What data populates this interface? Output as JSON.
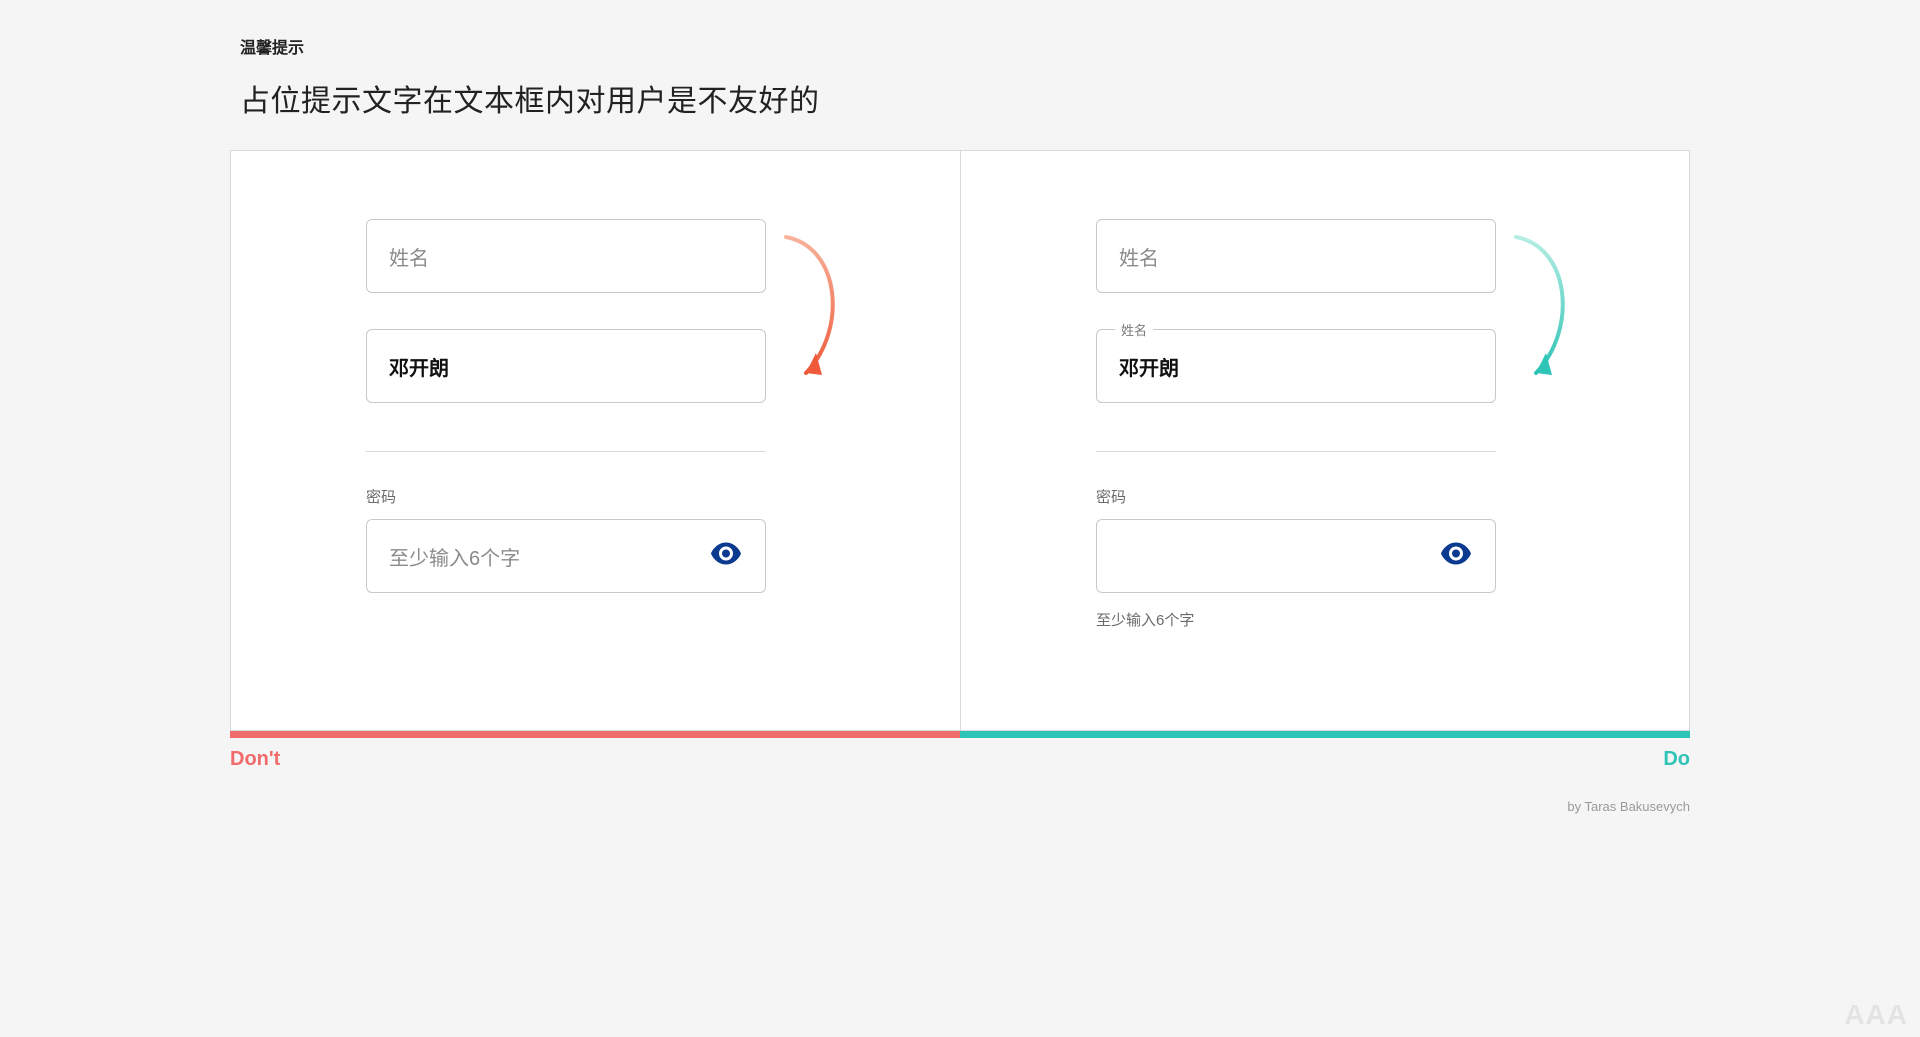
{
  "header": {
    "kicker": "温馨提示",
    "title": "占位提示文字在文本框内对用户是不友好的"
  },
  "colors": {
    "dont": "#f06b6b",
    "do": "#2ec4b6",
    "eye": "#0b3a8f"
  },
  "dont_panel": {
    "name_placeholder": "姓名",
    "name_value": "邓开朗",
    "password_label": "密码",
    "password_placeholder": "至少输入6个字"
  },
  "do_panel": {
    "name_placeholder": "姓名",
    "name_float_label": "姓名",
    "name_value": "邓开朗",
    "password_label": "密码",
    "password_help": "至少输入6个字"
  },
  "captions": {
    "dont": "Don't",
    "do": "Do"
  },
  "credit": "by Taras Bakusevych",
  "watermark": "AAA"
}
